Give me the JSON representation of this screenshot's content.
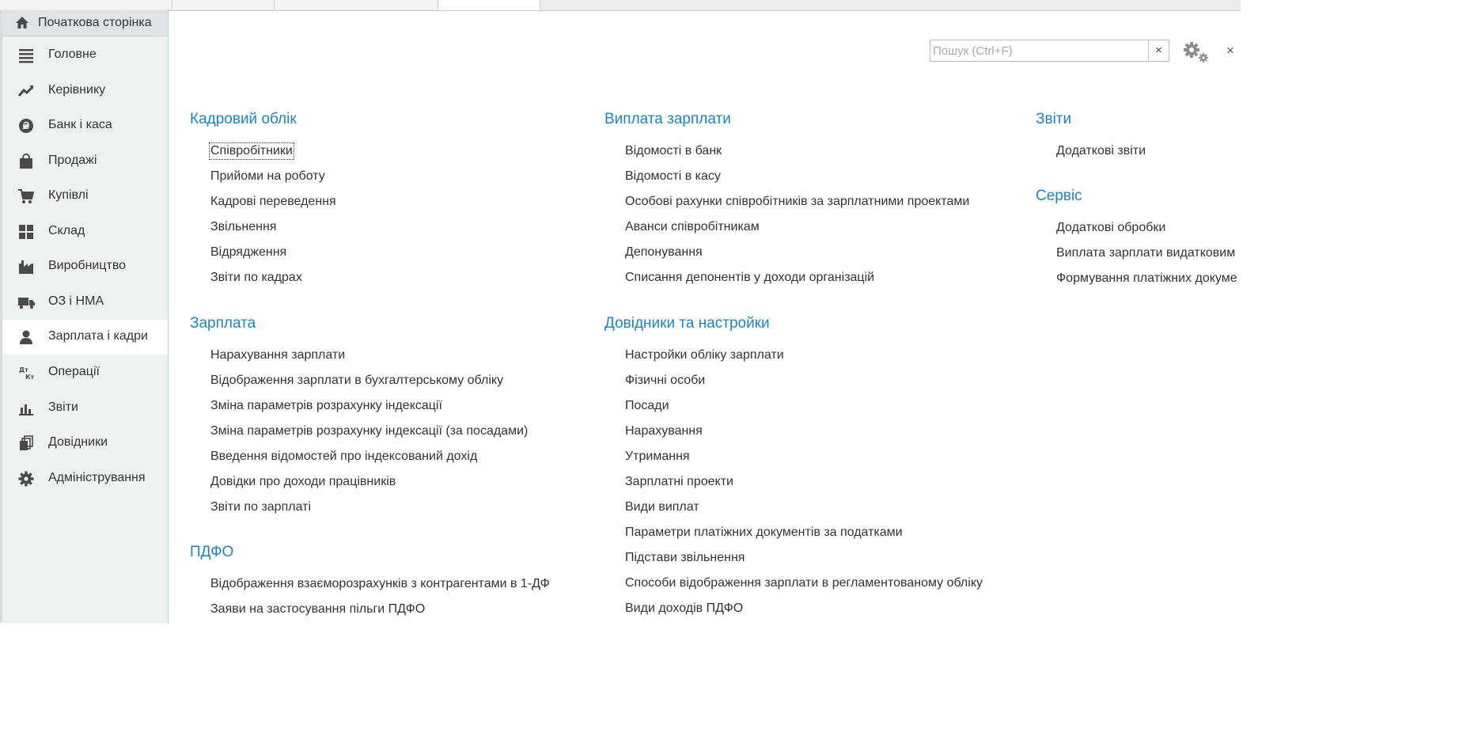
{
  "sidebar": {
    "home": {
      "label": "Початкова сторінка",
      "icon": "home-icon"
    },
    "items": [
      {
        "label": "Головне",
        "icon": "menu-lines-icon"
      },
      {
        "label": "Керівнику",
        "icon": "trend-chart-icon"
      },
      {
        "label": "Банк і каса",
        "icon": "hryvnia-coin-icon"
      },
      {
        "label": "Продажі",
        "icon": "shopping-bag-icon"
      },
      {
        "label": "Купівлі",
        "icon": "shopping-cart-icon"
      },
      {
        "label": "Склад",
        "icon": "warehouse-grid-icon"
      },
      {
        "label": "Виробництво",
        "icon": "factory-icon"
      },
      {
        "label": "ОЗ і НМА",
        "icon": "truck-icon"
      },
      {
        "label": "Зарплата і кадри",
        "icon": "person-icon",
        "active": true
      },
      {
        "label": "Операції",
        "icon": "debit-credit-icon"
      },
      {
        "label": "Звіти",
        "icon": "bar-chart-icon"
      },
      {
        "label": "Довідники",
        "icon": "books-icon"
      },
      {
        "label": "Адміністрування",
        "icon": "gear-icon"
      }
    ]
  },
  "header": {
    "search_placeholder": "Пошук (Ctrl+F)",
    "search_value": "",
    "clear_label": "×",
    "close_label": "×"
  },
  "sections": {
    "personnel": {
      "title": "Кадровий облік",
      "links": [
        "Співробітники",
        "Прийоми на роботу",
        "Кадрові переведення",
        "Звільнення",
        "Відрядження",
        "Звіти по кадрах"
      ]
    },
    "salary": {
      "title": "Зарплата",
      "links": [
        "Нарахування зарплати",
        "Відображення зарплати в бухгалтерському обліку",
        "Зміна параметрів розрахунку індексації",
        "Зміна параметрів розрахунку індексації (за посадами)",
        "Введення відомостей про індексований дохід",
        "Довідки про доходи працівників",
        "Звіти по зарплаті"
      ]
    },
    "pdfo": {
      "title": "ПДФО",
      "links": [
        "Відображення взаєморозрахунків з контрагентами в 1-ДФ",
        "Заяви на застосування пільги ПДФО"
      ]
    },
    "payout": {
      "title": "Виплата зарплати",
      "links": [
        "Відомості в банк",
        "Відомості в касу",
        "Особові рахунки співробітників за зарплатними проектами",
        "Аванси співробітникам",
        "Депонування",
        "Списання депонентів у доходи організацій"
      ]
    },
    "directories": {
      "title": "Довідники та настройки",
      "links": [
        "Настройки обліку зарплати",
        "Фізичні особи",
        "Посади",
        "Нарахування",
        "Утримання",
        "Зарплатні проекти",
        "Види виплат",
        "Параметри платіжних документів за податками",
        "Підстави звільнення",
        "Способи відображення зарплати в регламентованому обліку",
        "Види доходів ПДФО"
      ]
    },
    "reports": {
      "title": "Звіти",
      "links": [
        "Додаткові звіти"
      ]
    },
    "service": {
      "title": "Сервіс",
      "links": [
        "Додаткові обробки",
        "Виплата зарплати видатковим",
        "Формування платіжних докуме"
      ]
    }
  },
  "colors": {
    "section_title": "#1c84c6",
    "sidebar_bg": "#eef1f2",
    "sidebar_active_bg": "#ffffff",
    "icon": "#4a4a4a"
  }
}
